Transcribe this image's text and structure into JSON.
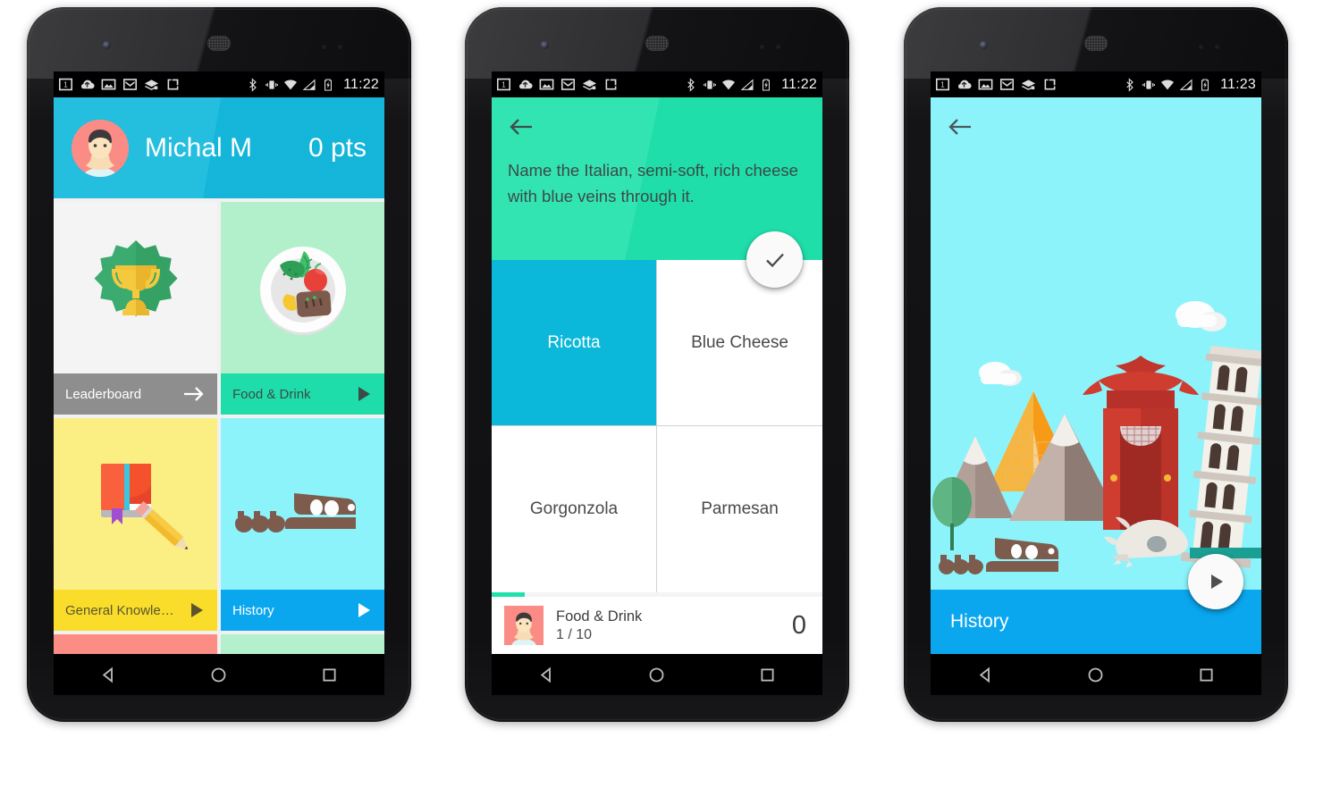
{
  "status_bar": {
    "time_phone1": "11:22",
    "time_phone2": "11:22",
    "time_phone3": "11:23",
    "left_icons": [
      "sim-card-icon",
      "cloud-upload-icon",
      "photo-icon",
      "gmail-icon",
      "wifi-transfer-icon",
      "screen-record-icon"
    ],
    "right_icons": [
      "bluetooth-icon",
      "vibrate-icon",
      "wifi-icon",
      "cellular-signal-icon",
      "battery-charging-icon"
    ]
  },
  "nav_bar": {
    "back_label": "Back",
    "home_label": "Home",
    "recents_label": "Recents"
  },
  "phone1": {
    "user": {
      "name": "Michal M",
      "points": "0 pts",
      "avatar": "user-avatar"
    },
    "tiles": [
      {
        "id": "leaderboard",
        "label": "Leaderboard",
        "art": "trophy-badge-icon",
        "action_icon": "arrow-right-icon",
        "art_bg": "#f4f4f4",
        "foot_bg": "#8e8e8e",
        "foot_fg": "#ffffff"
      },
      {
        "id": "food-drink",
        "label": "Food & Drink",
        "art": "plate-of-food-icon",
        "action_icon": "play-icon",
        "art_bg": "#b2efcb",
        "foot_bg": "#1fddaa",
        "foot_fg": "#3b4b46"
      },
      {
        "id": "general-knowledge",
        "label": "General Knowledge",
        "art": "book-and-pencil-icon",
        "action_icon": "play-icon",
        "art_bg": "#fbef84",
        "foot_bg": "#f9dd2a",
        "foot_fg": "#5a5530"
      },
      {
        "id": "history",
        "label": "History",
        "art": "dinosaur-skeleton-icon",
        "action_icon": "play-icon",
        "art_bg": "#8df3fb",
        "foot_bg": "#0aa7ef",
        "foot_fg": "#ffffff"
      }
    ],
    "partial_tiles": [
      {
        "id": "partial-left",
        "color": "#fc8d84"
      },
      {
        "id": "partial-right",
        "color": "#b5f0cd"
      }
    ]
  },
  "phone2": {
    "back_icon": "arrow-left-icon",
    "question": "Name the Italian, semi-soft, rich cheese with blue veins through it.",
    "confirm_icon": "check-icon",
    "answers": [
      {
        "text": "Ricotta",
        "selected": true
      },
      {
        "text": "Blue Cheese",
        "selected": false
      },
      {
        "text": "Gorgonzola",
        "selected": false
      },
      {
        "text": "Parmesan",
        "selected": false
      }
    ],
    "progress_percent": 10,
    "score_bar": {
      "avatar": "user-avatar",
      "category": "Food & Drink",
      "counter": "1 / 10",
      "score": "0"
    },
    "colors": {
      "header": "#1fe1ac",
      "selected_answer": "#0bb8d9",
      "progress": "#1fe1ac"
    }
  },
  "phone3": {
    "back_icon": "arrow-left-icon",
    "title": "History",
    "play_icon": "play-icon",
    "illustration": "history-landmarks-illustration",
    "illustration_elements": [
      "tree",
      "cloud",
      "cloud",
      "pyramid",
      "mountain",
      "mountain",
      "chinese-gate",
      "leaning-tower-of-pisa",
      "dinosaur-skeleton",
      "animal-skull"
    ],
    "colors": {
      "sky": "#8df3fb",
      "footer": "#0aa7ef"
    }
  }
}
